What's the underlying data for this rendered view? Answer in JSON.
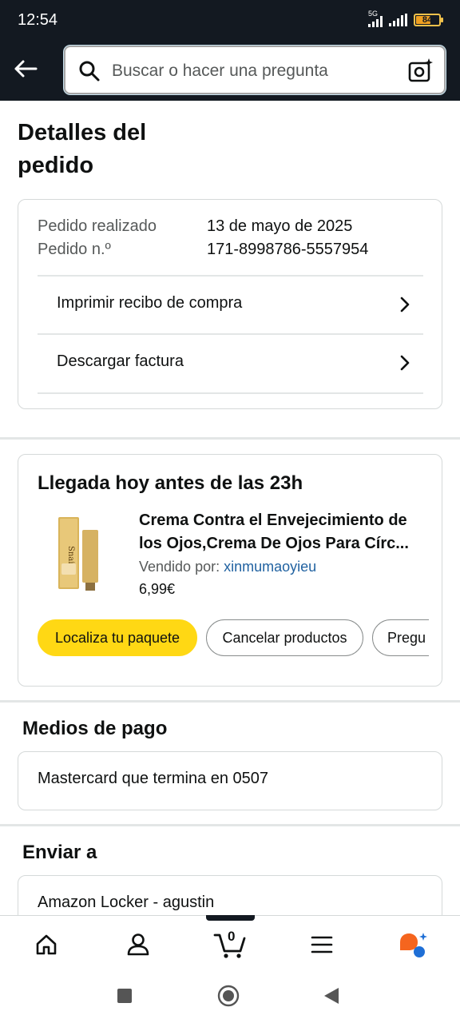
{
  "status_bar": {
    "time": "12:54",
    "network": "5G",
    "battery": "84"
  },
  "header": {
    "search_placeholder": "Buscar o hacer una pregunta"
  },
  "page": {
    "title_line1": "Detalles del",
    "title_line2": "pedido"
  },
  "order": {
    "placed_label": "Pedido realizado",
    "placed_value": "13 de mayo de 2025",
    "number_label": "Pedido n.º",
    "number_value": "171-8998786-5557954",
    "links": [
      "Imprimir recibo de compra",
      "Descargar factura"
    ]
  },
  "shipment": {
    "title": "Llegada hoy antes de las 23h",
    "product_name": "Crema Contra el Envejecimiento de los Ojos,Crema De Ojos Para Círc...",
    "product_image_text": "Snail",
    "seller_label": "Vendido por:",
    "seller_name": "xinmumaoyieu",
    "price": "6,99€",
    "buttons": [
      "Localiza tu paquete",
      "Cancelar productos",
      "Pregu"
    ]
  },
  "payment": {
    "heading": "Medios de pago",
    "method": "Mastercard  que termina en 0507"
  },
  "shipping": {
    "heading": "Enviar a",
    "address": "Amazon Locker - agustin"
  },
  "bottom_nav": {
    "cart_count": "0"
  },
  "colors": {
    "header_bg": "#131921",
    "primary_button": "#ffd814",
    "link": "#2162a1"
  }
}
